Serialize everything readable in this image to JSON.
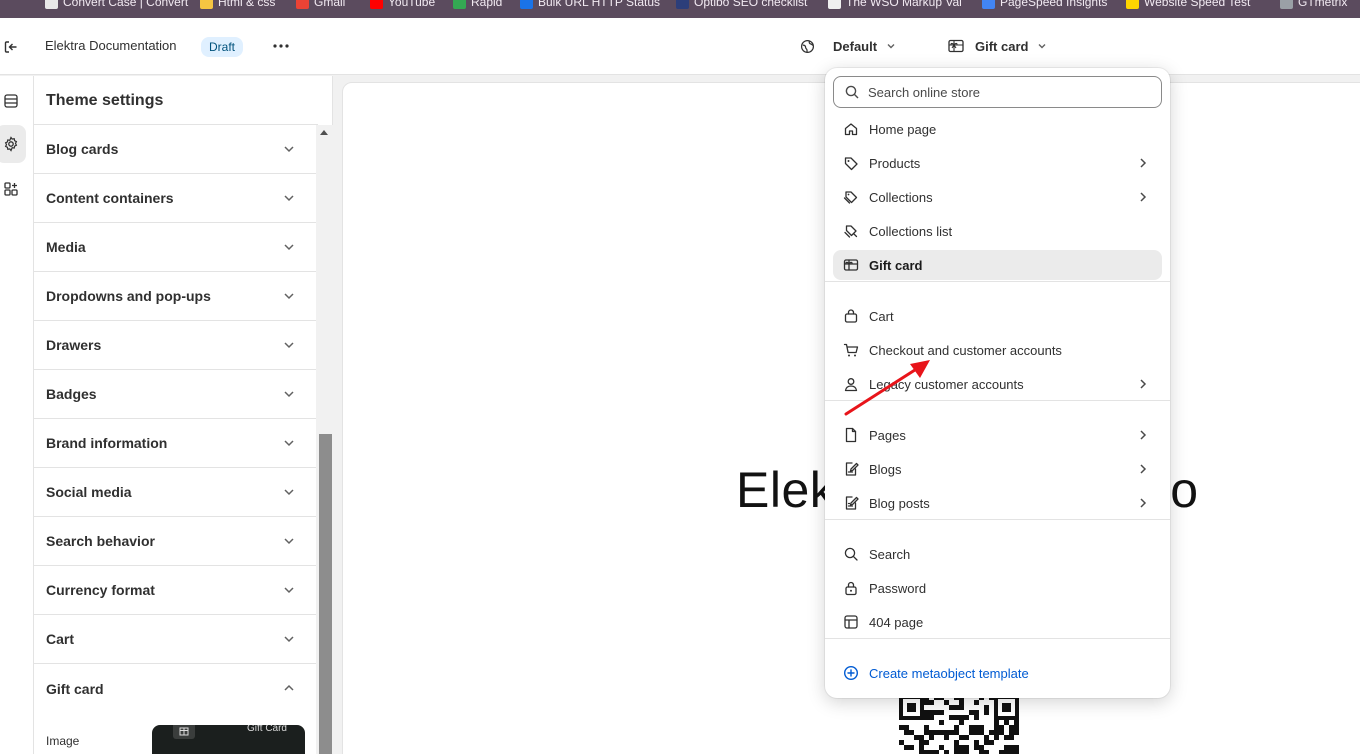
{
  "bookmarks": [
    {
      "label": "Convert Case | Convert",
      "color": "#e8e8e8"
    },
    {
      "label": "Html & css",
      "color": "#f5c542"
    },
    {
      "label": "Gmail",
      "color": "#ea4335"
    },
    {
      "label": "YouTube",
      "color": "#ff0000"
    },
    {
      "label": "Rapid",
      "color": "#34a853"
    },
    {
      "label": "Bulk URL HTTP Status",
      "color": "#1a73e8"
    },
    {
      "label": "Optibo SEO checklist",
      "color": "#2c3e7a"
    },
    {
      "label": "The WSO Markup Val",
      "color": "#f0f0f0"
    },
    {
      "label": "PageSpeed Insights",
      "color": "#4285f4"
    },
    {
      "label": "Website Speed Test",
      "color": "#ffd600"
    },
    {
      "label": "GTmetrix",
      "color": "#9aa0a6"
    }
  ],
  "header": {
    "store_title": "Elektra Documentation",
    "badge": "Draft",
    "theme_select": "Default",
    "template_select": "Gift card"
  },
  "panel": {
    "title": "Theme settings",
    "items": [
      {
        "label": "Blog cards",
        "expanded": false
      },
      {
        "label": "Content containers",
        "expanded": false
      },
      {
        "label": "Media",
        "expanded": false
      },
      {
        "label": "Dropdowns and pop-ups",
        "expanded": false
      },
      {
        "label": "Drawers",
        "expanded": false
      },
      {
        "label": "Badges",
        "expanded": false
      },
      {
        "label": "Brand information",
        "expanded": false
      },
      {
        "label": "Social media",
        "expanded": false
      },
      {
        "label": "Search behavior",
        "expanded": false
      },
      {
        "label": "Currency format",
        "expanded": false
      },
      {
        "label": "Cart",
        "expanded": false
      },
      {
        "label": "Gift card",
        "expanded": true
      }
    ],
    "gift_card_sub": {
      "image_label": "Image",
      "preview_text": "Gift Card"
    }
  },
  "canvas": {
    "hero_left": "Elek",
    "hero_right": "o"
  },
  "dropdown": {
    "search_placeholder": "Search online store",
    "groups": [
      [
        {
          "label": "Home page",
          "icon": "home-icon",
          "submenu": false
        },
        {
          "label": "Products",
          "icon": "tag-icon",
          "submenu": true
        },
        {
          "label": "Collections",
          "icon": "collection-icon",
          "submenu": true
        },
        {
          "label": "Collections list",
          "icon": "collections-list-icon",
          "submenu": false
        },
        {
          "label": "Gift card",
          "icon": "gift-card-icon",
          "submenu": false,
          "selected": true
        }
      ],
      [
        {
          "label": "Cart",
          "icon": "bag-icon",
          "submenu": false
        },
        {
          "label": "Checkout and customer accounts",
          "icon": "cart-icon",
          "submenu": false
        },
        {
          "label": "Legacy customer accounts",
          "icon": "person-icon",
          "submenu": true
        }
      ],
      [
        {
          "label": "Pages",
          "icon": "page-icon",
          "submenu": true
        },
        {
          "label": "Blogs",
          "icon": "blog-icon",
          "submenu": true
        },
        {
          "label": "Blog posts",
          "icon": "blog-post-icon",
          "submenu": true
        }
      ],
      [
        {
          "label": "Search",
          "icon": "search-icon",
          "submenu": false
        },
        {
          "label": "Password",
          "icon": "lock-icon",
          "submenu": false
        },
        {
          "label": "404 page",
          "icon": "not-found-icon",
          "submenu": false
        }
      ]
    ],
    "create_link": "Create metaobject template",
    "accent_color": "#005bd3",
    "selected_bg": "#ebebeb"
  },
  "annotation": {
    "arrow_color": "#e8141a"
  }
}
